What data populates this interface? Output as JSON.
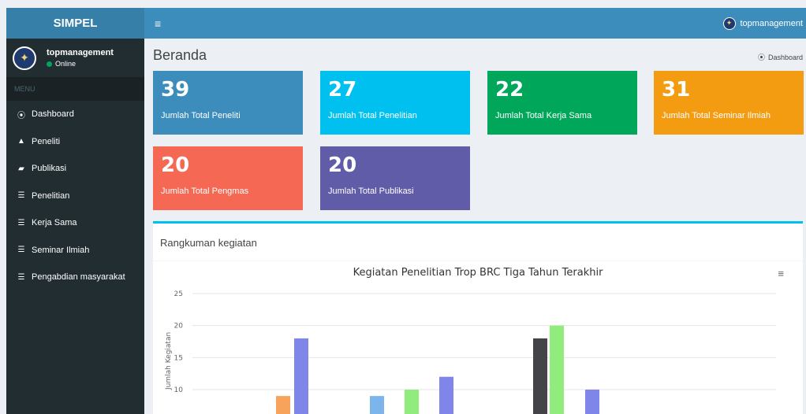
{
  "app": {
    "logo": "SIMPEL"
  },
  "sidebar": {
    "user": {
      "name": "topmanagement",
      "status": "Online"
    },
    "menu_header": "MENU",
    "items": [
      {
        "icon": "dashboard-icon",
        "glyph": "⦿",
        "label": "Dashboard"
      },
      {
        "icon": "user-icon",
        "glyph": "▲",
        "label": "Peneliti"
      },
      {
        "icon": "book-icon",
        "glyph": "▰",
        "label": "Publikasi"
      },
      {
        "icon": "list-icon",
        "glyph": "☰",
        "label": "Penelitian"
      },
      {
        "icon": "list-icon",
        "glyph": "☰",
        "label": "Kerja Sama"
      },
      {
        "icon": "list-icon",
        "glyph": "☰",
        "label": "Seminar Ilmiah"
      },
      {
        "icon": "list-icon",
        "glyph": "☰",
        "label": "Pengabdian masyarakat"
      }
    ]
  },
  "topbar": {
    "menu_glyph": "≡",
    "user": "topmanagement"
  },
  "page": {
    "title": "Beranda",
    "breadcrumb": "Dashboard"
  },
  "stats": [
    {
      "value": "39",
      "label": "Jumlah Total Peneliti",
      "color": "#3c8dbc"
    },
    {
      "value": "27",
      "label": "Jumlah Total Penelitian",
      "color": "#00c0ef"
    },
    {
      "value": "22",
      "label": "Jumlah Total Kerja Sama",
      "color": "#00a65a"
    },
    {
      "value": "31",
      "label": "Jumlah Total Seminar Ilmiah",
      "color": "#f39c12"
    },
    {
      "value": "20",
      "label": "Jumlah Total Pengmas",
      "color": "#f56954"
    },
    {
      "value": "20",
      "label": "Jumlah Total Publikasi",
      "color": "#605ca8"
    }
  ],
  "panel": {
    "title": "Rangkuman kegiatan",
    "menu_glyph": "≡"
  },
  "chart_data": {
    "type": "bar",
    "title": "Kegiatan Penelitian Trop BRC Tiga Tahun Terakhir",
    "ylabel": "Jumlah Kegiatan",
    "ylim": [
      0,
      25
    ],
    "yticks": [
      10,
      15,
      20,
      25
    ],
    "grid": true,
    "series": [
      {
        "color": "#f7a35c",
        "values": [
          9,
          null,
          null,
          null
        ]
      },
      {
        "color": "#8085e9",
        "values": [
          18,
          null,
          12,
          10
        ]
      },
      {
        "color": "#7cb5ec",
        "values": [
          null,
          9,
          null,
          null
        ]
      },
      {
        "color": "#90ed7d",
        "values": [
          null,
          10,
          20,
          null
        ]
      },
      {
        "color": "#434348",
        "values": [
          null,
          null,
          18,
          null
        ]
      }
    ]
  }
}
